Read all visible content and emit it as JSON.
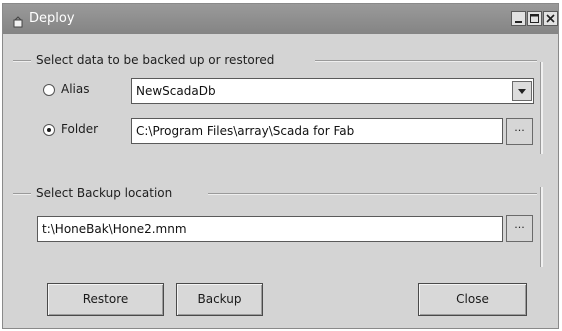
{
  "window": {
    "title": "Deploy"
  },
  "data_group": {
    "label": "Select data to be backed up or restored",
    "alias_label": "Alias",
    "alias_value": "NewScadaDb",
    "alias_selected": false,
    "folder_label": "Folder",
    "folder_value": "C:\\Program Files\\array\\Scada for Fab",
    "folder_selected": true,
    "browse_label": "..."
  },
  "backup_group": {
    "label": "Select Backup location",
    "location_value": "t:\\HoneBak\\Hone2.mnm",
    "browse_label": "..."
  },
  "buttons": {
    "restore": "Restore",
    "backup": "Backup",
    "close": "Close"
  },
  "icons": {
    "window_icon": "app-icon",
    "minimize": "minimize-icon",
    "maximize": "maximize-icon",
    "close": "close-icon",
    "dropdown": "chevron-down-icon"
  }
}
